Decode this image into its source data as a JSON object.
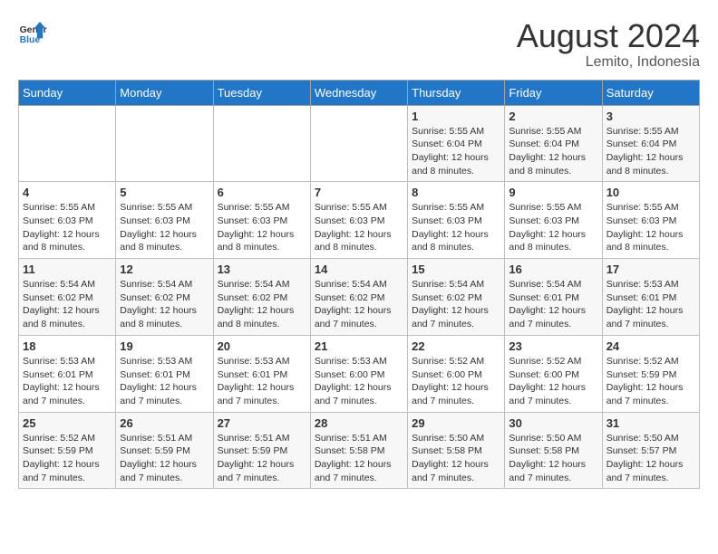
{
  "header": {
    "logo_line1": "General",
    "logo_line2": "Blue",
    "title": "August 2024",
    "subtitle": "Lemito, Indonesia"
  },
  "days_of_week": [
    "Sunday",
    "Monday",
    "Tuesday",
    "Wednesday",
    "Thursday",
    "Friday",
    "Saturday"
  ],
  "weeks": [
    [
      {
        "day": "",
        "info": ""
      },
      {
        "day": "",
        "info": ""
      },
      {
        "day": "",
        "info": ""
      },
      {
        "day": "",
        "info": ""
      },
      {
        "day": "1",
        "info": "Sunrise: 5:55 AM\nSunset: 6:04 PM\nDaylight: 12 hours\nand 8 minutes."
      },
      {
        "day": "2",
        "info": "Sunrise: 5:55 AM\nSunset: 6:04 PM\nDaylight: 12 hours\nand 8 minutes."
      },
      {
        "day": "3",
        "info": "Sunrise: 5:55 AM\nSunset: 6:04 PM\nDaylight: 12 hours\nand 8 minutes."
      }
    ],
    [
      {
        "day": "4",
        "info": "Sunrise: 5:55 AM\nSunset: 6:03 PM\nDaylight: 12 hours\nand 8 minutes."
      },
      {
        "day": "5",
        "info": "Sunrise: 5:55 AM\nSunset: 6:03 PM\nDaylight: 12 hours\nand 8 minutes."
      },
      {
        "day": "6",
        "info": "Sunrise: 5:55 AM\nSunset: 6:03 PM\nDaylight: 12 hours\nand 8 minutes."
      },
      {
        "day": "7",
        "info": "Sunrise: 5:55 AM\nSunset: 6:03 PM\nDaylight: 12 hours\nand 8 minutes."
      },
      {
        "day": "8",
        "info": "Sunrise: 5:55 AM\nSunset: 6:03 PM\nDaylight: 12 hours\nand 8 minutes."
      },
      {
        "day": "9",
        "info": "Sunrise: 5:55 AM\nSunset: 6:03 PM\nDaylight: 12 hours\nand 8 minutes."
      },
      {
        "day": "10",
        "info": "Sunrise: 5:55 AM\nSunset: 6:03 PM\nDaylight: 12 hours\nand 8 minutes."
      }
    ],
    [
      {
        "day": "11",
        "info": "Sunrise: 5:54 AM\nSunset: 6:02 PM\nDaylight: 12 hours\nand 8 minutes."
      },
      {
        "day": "12",
        "info": "Sunrise: 5:54 AM\nSunset: 6:02 PM\nDaylight: 12 hours\nand 8 minutes."
      },
      {
        "day": "13",
        "info": "Sunrise: 5:54 AM\nSunset: 6:02 PM\nDaylight: 12 hours\nand 8 minutes."
      },
      {
        "day": "14",
        "info": "Sunrise: 5:54 AM\nSunset: 6:02 PM\nDaylight: 12 hours\nand 7 minutes."
      },
      {
        "day": "15",
        "info": "Sunrise: 5:54 AM\nSunset: 6:02 PM\nDaylight: 12 hours\nand 7 minutes."
      },
      {
        "day": "16",
        "info": "Sunrise: 5:54 AM\nSunset: 6:01 PM\nDaylight: 12 hours\nand 7 minutes."
      },
      {
        "day": "17",
        "info": "Sunrise: 5:53 AM\nSunset: 6:01 PM\nDaylight: 12 hours\nand 7 minutes."
      }
    ],
    [
      {
        "day": "18",
        "info": "Sunrise: 5:53 AM\nSunset: 6:01 PM\nDaylight: 12 hours\nand 7 minutes."
      },
      {
        "day": "19",
        "info": "Sunrise: 5:53 AM\nSunset: 6:01 PM\nDaylight: 12 hours\nand 7 minutes."
      },
      {
        "day": "20",
        "info": "Sunrise: 5:53 AM\nSunset: 6:01 PM\nDaylight: 12 hours\nand 7 minutes."
      },
      {
        "day": "21",
        "info": "Sunrise: 5:53 AM\nSunset: 6:00 PM\nDaylight: 12 hours\nand 7 minutes."
      },
      {
        "day": "22",
        "info": "Sunrise: 5:52 AM\nSunset: 6:00 PM\nDaylight: 12 hours\nand 7 minutes."
      },
      {
        "day": "23",
        "info": "Sunrise: 5:52 AM\nSunset: 6:00 PM\nDaylight: 12 hours\nand 7 minutes."
      },
      {
        "day": "24",
        "info": "Sunrise: 5:52 AM\nSunset: 5:59 PM\nDaylight: 12 hours\nand 7 minutes."
      }
    ],
    [
      {
        "day": "25",
        "info": "Sunrise: 5:52 AM\nSunset: 5:59 PM\nDaylight: 12 hours\nand 7 minutes."
      },
      {
        "day": "26",
        "info": "Sunrise: 5:51 AM\nSunset: 5:59 PM\nDaylight: 12 hours\nand 7 minutes."
      },
      {
        "day": "27",
        "info": "Sunrise: 5:51 AM\nSunset: 5:59 PM\nDaylight: 12 hours\nand 7 minutes."
      },
      {
        "day": "28",
        "info": "Sunrise: 5:51 AM\nSunset: 5:58 PM\nDaylight: 12 hours\nand 7 minutes."
      },
      {
        "day": "29",
        "info": "Sunrise: 5:50 AM\nSunset: 5:58 PM\nDaylight: 12 hours\nand 7 minutes."
      },
      {
        "day": "30",
        "info": "Sunrise: 5:50 AM\nSunset: 5:58 PM\nDaylight: 12 hours\nand 7 minutes."
      },
      {
        "day": "31",
        "info": "Sunrise: 5:50 AM\nSunset: 5:57 PM\nDaylight: 12 hours\nand 7 minutes."
      }
    ]
  ]
}
